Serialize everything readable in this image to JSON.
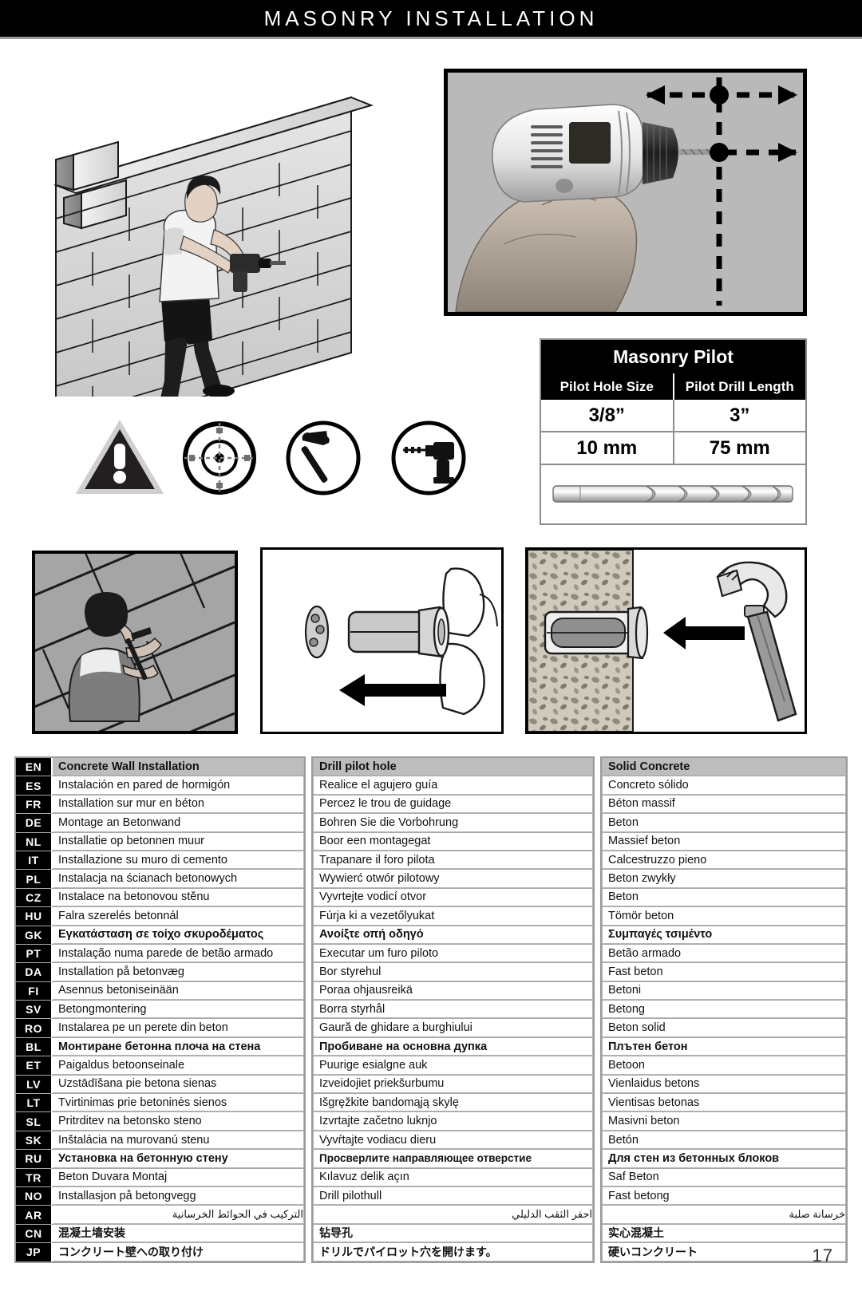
{
  "header": {
    "title": "MASONRY INSTALLATION"
  },
  "pilot_table": {
    "title": "Masonry Pilot",
    "col1_header": "Pilot Hole Size",
    "col2_header": "Pilot Drill Length",
    "rows": [
      {
        "hole": "3/8”",
        "length": "3”"
      },
      {
        "hole": "10 mm",
        "length": "75 mm"
      }
    ]
  },
  "icons": [
    {
      "name": "warning-triangle-icon"
    },
    {
      "name": "target-crosshair-icon"
    },
    {
      "name": "hammer-circle-icon"
    },
    {
      "name": "drill-circle-icon"
    }
  ],
  "illustrations": {
    "wall_drill": "person drilling into masonry block wall",
    "drill_photo": "hand holding cordless drill with crosshair guide lines",
    "hammer_wall": "person hammering anchor into masonry wall",
    "anchor_insert": "hand pushing masonry anchor sleeve",
    "anchor_driven": "hammer driving anchor into concrete"
  },
  "language_table": {
    "columns": [
      {
        "id": "concrete-wall-installation",
        "rows": [
          {
            "code": "EN",
            "text": "Concrete Wall Installation",
            "header": true
          },
          {
            "code": "ES",
            "text": "Instalación en pared de hormigón"
          },
          {
            "code": "FR",
            "text": "Installation sur mur en béton"
          },
          {
            "code": "DE",
            "text": "Montage an Betonwand"
          },
          {
            "code": "NL",
            "text": "Installatie op betonnen muur"
          },
          {
            "code": "IT",
            "text": "Installazione su muro di cemento"
          },
          {
            "code": "PL",
            "text": "Instalacja na ścianach betonowych"
          },
          {
            "code": "CZ",
            "text": "Instalace na betonovou stěnu"
          },
          {
            "code": "HU",
            "text": "Falra szerelés betonnál"
          },
          {
            "code": "GK",
            "text": "Εγκατάσταση σε τοίχο σκυροδέματος",
            "bold": true
          },
          {
            "code": "PT",
            "text": "Instalação numa parede de betão armado"
          },
          {
            "code": "DA",
            "text": "Installation på betonvæg"
          },
          {
            "code": "FI",
            "text": "Asennus betoniseinään"
          },
          {
            "code": "SV",
            "text": "Betongmontering"
          },
          {
            "code": "RO",
            "text": "Instalarea pe un perete din beton"
          },
          {
            "code": "BL",
            "text": "Монтиране бетонна плоча на стена",
            "bold": true
          },
          {
            "code": "ET",
            "text": "Paigaldus betoonseinale"
          },
          {
            "code": "LV",
            "text": "Uzstādīšana pie betona sienas"
          },
          {
            "code": "LT",
            "text": "Tvirtinimas prie betoninės sienos"
          },
          {
            "code": "SL",
            "text": "Pritrditev na betonsko steno"
          },
          {
            "code": "SK",
            "text": "Inštalácia na murovanú stenu"
          },
          {
            "code": "RU",
            "text": "Установка на бетонную стену",
            "bold": true
          },
          {
            "code": "TR",
            "text": "Beton Duvara Montaj"
          },
          {
            "code": "NO",
            "text": "Installasjon på betongvegg"
          },
          {
            "code": "AR",
            "text": "التركيب في الحوائط الخرسانية",
            "rtl": true
          },
          {
            "code": "CN",
            "text": "混凝土墙安装",
            "cjk": true
          },
          {
            "code": "JP",
            "text": "コンクリート壁への取り付け",
            "cjk": true
          }
        ]
      },
      {
        "id": "drill-pilot-hole",
        "rows": [
          {
            "text": "Drill pilot hole",
            "header": true
          },
          {
            "text": "Realice el agujero guía"
          },
          {
            "text": "Percez le trou de guidage"
          },
          {
            "text": "Bohren Sie die Vorbohrung"
          },
          {
            "text": "Boor een montagegat"
          },
          {
            "text": "Trapanare il foro pilota"
          },
          {
            "text": "Wywierć otwór pilotowy"
          },
          {
            "text": "Vyvrtejte vodicí otvor"
          },
          {
            "text": "Fúrja ki a vezetőlyukat"
          },
          {
            "text": "Ανοίξτε οπή οδηγό",
            "bold": true
          },
          {
            "text": "Executar um furo piloto"
          },
          {
            "text": "Bor styrehul"
          },
          {
            "text": "Poraa ohjausreikä"
          },
          {
            "text": "Borra styrhål"
          },
          {
            "text": "Gaură de ghidare a burghiului"
          },
          {
            "text": "Пробиване на основна дупка",
            "bold": true
          },
          {
            "text": "Puurige esialgne auk"
          },
          {
            "text": "Izveidojiet priekšurbumu"
          },
          {
            "text": "Išgręžkite bandomąją skylę"
          },
          {
            "text": "Izvrtajte začetno luknjo"
          },
          {
            "text": "Vyvŕtajte vodiacu dieru"
          },
          {
            "text": "Просверлите направляющее отверстие",
            "bold": true,
            "small": true
          },
          {
            "text": "Kılavuz delik açın"
          },
          {
            "text": "Drill pilothull"
          },
          {
            "text": "احفر الثقب الدليلي",
            "rtl": true
          },
          {
            "text": "钻导孔",
            "cjk": true
          },
          {
            "text": "ドリルでパイロット穴を開けます。",
            "cjk": true
          }
        ]
      },
      {
        "id": "solid-concrete",
        "rows": [
          {
            "text": "Solid Concrete",
            "header": true
          },
          {
            "text": "Concreto sólido"
          },
          {
            "text": "Béton massif"
          },
          {
            "text": "Beton"
          },
          {
            "text": "Massief beton"
          },
          {
            "text": "Calcestruzzo pieno"
          },
          {
            "text": "Beton zwykły"
          },
          {
            "text": "Beton"
          },
          {
            "text": "Tömör beton"
          },
          {
            "text": "Συμπαγές τσιμέντο",
            "bold": true
          },
          {
            "text": "Betão armado"
          },
          {
            "text": "Fast beton"
          },
          {
            "text": "Betoni"
          },
          {
            "text": "Betong"
          },
          {
            "text": "Beton solid"
          },
          {
            "text": "Плътен бетон",
            "bold": true
          },
          {
            "text": "Betoon"
          },
          {
            "text": "Vienlaidus betons"
          },
          {
            "text": "Vientisas betonas"
          },
          {
            "text": "Masivni beton"
          },
          {
            "text": "Betón"
          },
          {
            "text": "Для стен из бетонных блоков",
            "bold": true
          },
          {
            "text": "Saf Beton"
          },
          {
            "text": "Fast betong"
          },
          {
            "text": "خرسانة صلبة",
            "rtl": true
          },
          {
            "text": "实心混凝土",
            "cjk": true
          },
          {
            "text": "硬いコンクリート",
            "cjk": true
          }
        ]
      }
    ]
  },
  "page_number": "17",
  "colors": {
    "header_bg": "#000000",
    "header_text": "#ffffff",
    "table_header_bg": "#bdbdbd",
    "code_bg": "#000000",
    "border": "#9b9b9b"
  }
}
